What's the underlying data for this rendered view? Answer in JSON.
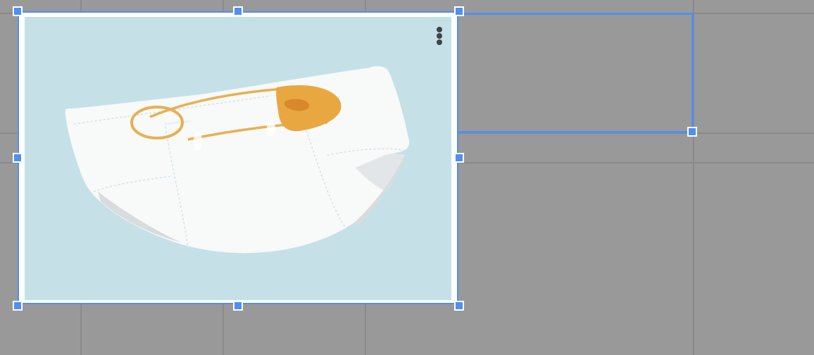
{
  "canvas": {
    "background_color": "#999999",
    "gridline_color": "#8a8a8a"
  },
  "image_element": {
    "subject": "diaper-with-safety-pin",
    "background_color": "#c5e1e7",
    "selection_color": "#4f8ff0",
    "menu_icon": "kebab-menu-icon"
  },
  "secondary_selection": {
    "border_color": "#4f8ff0"
  }
}
